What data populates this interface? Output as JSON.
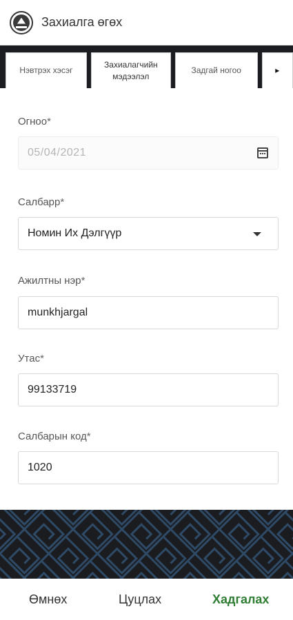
{
  "header": {
    "title": "Захиалга өгөх",
    "logo_icon": "temple-logo-icon"
  },
  "tabs": [
    {
      "label": "Нэвтрэх хэсэг"
    },
    {
      "label": "Захиалагчийн мэдээлэл",
      "active": true
    },
    {
      "label": "Задгай ногоо"
    },
    {
      "label": "▸",
      "icon": "chevron-right-icon"
    }
  ],
  "form": {
    "date": {
      "label": "Огноо",
      "required": "*",
      "value": "05/04/2021",
      "icon": "calendar-icon"
    },
    "branch": {
      "label": "Салбарр",
      "required": "*",
      "value": "Номин Их Дэлгүүр",
      "icon": "caret-down-icon"
    },
    "employee": {
      "label": "Ажилтны нэр",
      "required": "*",
      "value": "munkhjargal"
    },
    "phone": {
      "label": "Утас",
      "required": "*",
      "value": "99133719"
    },
    "branch_code": {
      "label": "Салбарын код",
      "required": "*",
      "value": "1020"
    }
  },
  "footer": {
    "prev_label": "Өмнөх",
    "cancel_label": "Цуцлах",
    "save_label": "Хадгалах"
  },
  "colors": {
    "dark": "#1b1d20",
    "pattern_line": "#2f4a66",
    "save": "#2e7d32"
  }
}
